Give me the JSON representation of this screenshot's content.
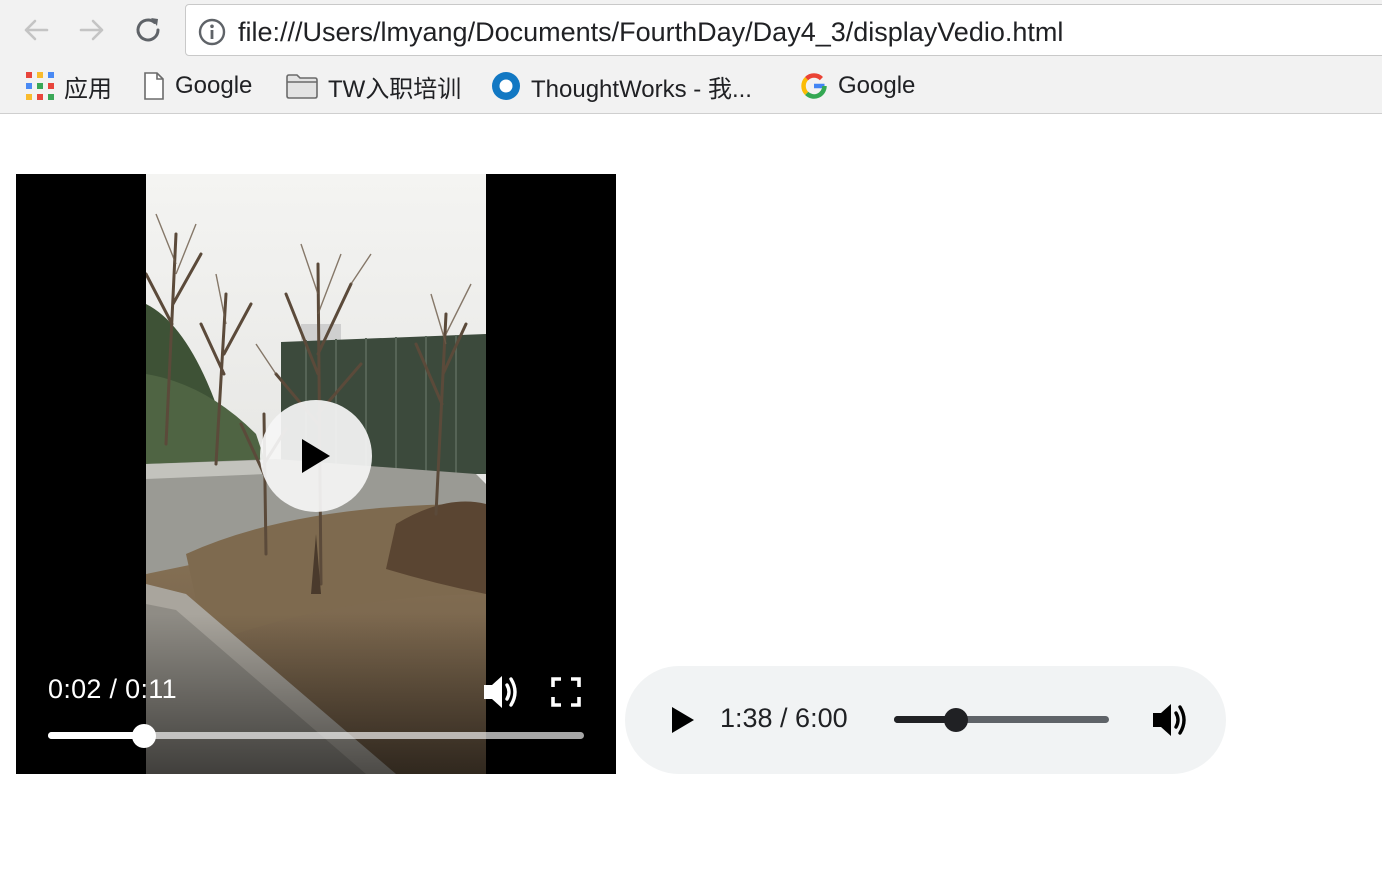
{
  "browser": {
    "url": "file:///Users/lmyang/Documents/FourthDay/Day4_3/displayVedio.html",
    "bookmarks": [
      {
        "label": "应用",
        "icon": "apps-grid-icon"
      },
      {
        "label": "Google",
        "icon": "page-icon"
      },
      {
        "label": "TW入职培训",
        "icon": "folder-icon"
      },
      {
        "label": "ThoughtWorks - 我...",
        "icon": "thoughtworks-logo-icon"
      },
      {
        "label": "Google",
        "icon": "google-g-icon"
      }
    ]
  },
  "video": {
    "time": "0:02 / 0:11",
    "progress": 0.18,
    "icons": [
      "play-icon",
      "volume-icon",
      "fullscreen-icon"
    ]
  },
  "audio": {
    "time": "1:38 / 6:00",
    "progress": 0.29,
    "icons": [
      "play-icon",
      "volume-icon"
    ]
  },
  "colors": {
    "chrome_bg": "#f2f2f2",
    "audio_bg": "#f1f3f4",
    "thoughtworks_blue": "#1278c3"
  }
}
